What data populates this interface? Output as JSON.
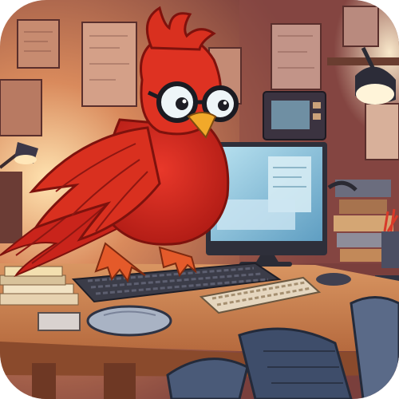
{
  "scene": {
    "subject": "red-cardinal-bird-with-glasses-at-computer",
    "colors": {
      "wall": "#b5644a",
      "wall_shadow": "#6e3a35",
      "lamp_glow": "#ffd9a0",
      "bird_red": "#d42a1f",
      "bird_dark": "#8e1712",
      "beak": "#f1a92a",
      "desk": "#c27a4a",
      "desk_front": "#8a4a2c",
      "monitor_screen": "#8fc7de",
      "monitor_frame": "#2e2f3a",
      "keyboard": "#3b3c48",
      "mouse": "#a9b3c4",
      "chair": "#4a5a78"
    }
  }
}
